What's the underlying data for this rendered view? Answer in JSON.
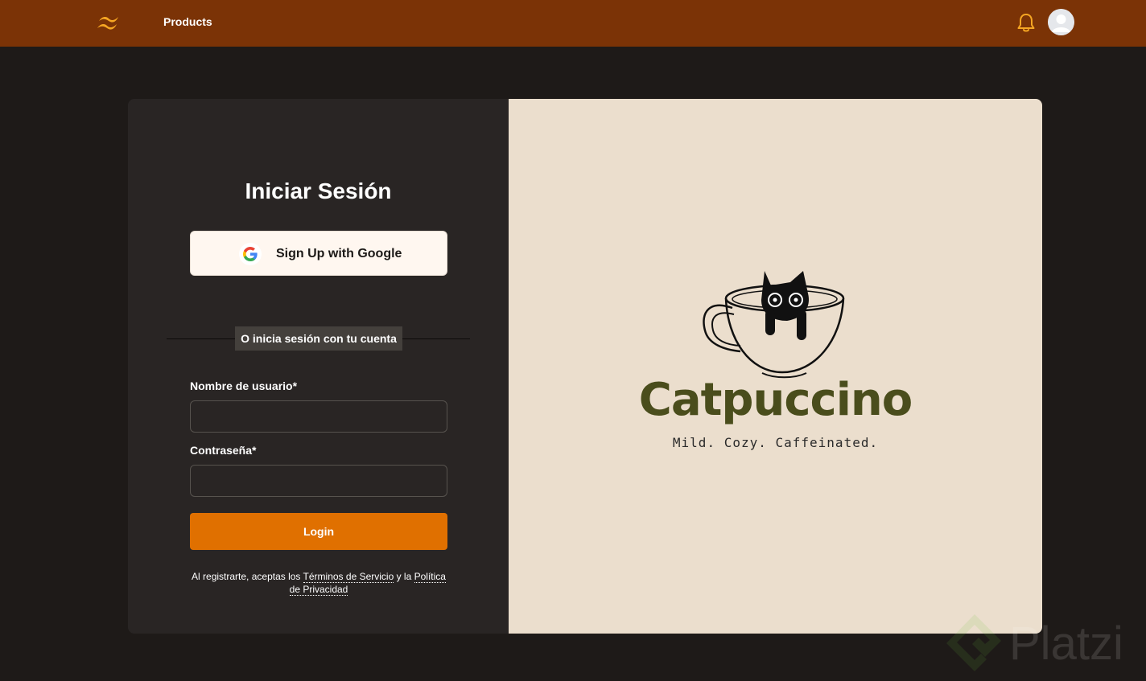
{
  "nav": {
    "products_label": "Products"
  },
  "login": {
    "title": "Iniciar Sesión",
    "google_button_label": "Sign Up with Google",
    "divider_text": "O inicia sesión con tu cuenta",
    "username_label": "Nombre de usuario*",
    "username_value": "",
    "password_label": "Contraseña*",
    "password_value": "",
    "login_button_label": "Login",
    "terms_prefix": "Al registrarte, aceptas los ",
    "terms_link": "Términos de Servicio",
    "terms_middle": " y la ",
    "privacy_link": "Política de Privacidad"
  },
  "brand": {
    "name": "Catpuccino",
    "tagline": "Mild. Cozy. Caffeinated."
  },
  "watermark": {
    "text": "Platzi"
  },
  "colors": {
    "topbar": "#7b3306",
    "page_background": "#1e1a18",
    "card_left": "#292524",
    "card_right": "#ebdecd",
    "accent_orange": "#e07000",
    "bell_yellow": "#f5a623",
    "brand_olive": "#4a4d1c"
  },
  "icons": {
    "logo": "tailwind-wave-logo",
    "notification": "bell-icon",
    "avatar": "user-avatar-icon",
    "google": "google-g-icon"
  }
}
